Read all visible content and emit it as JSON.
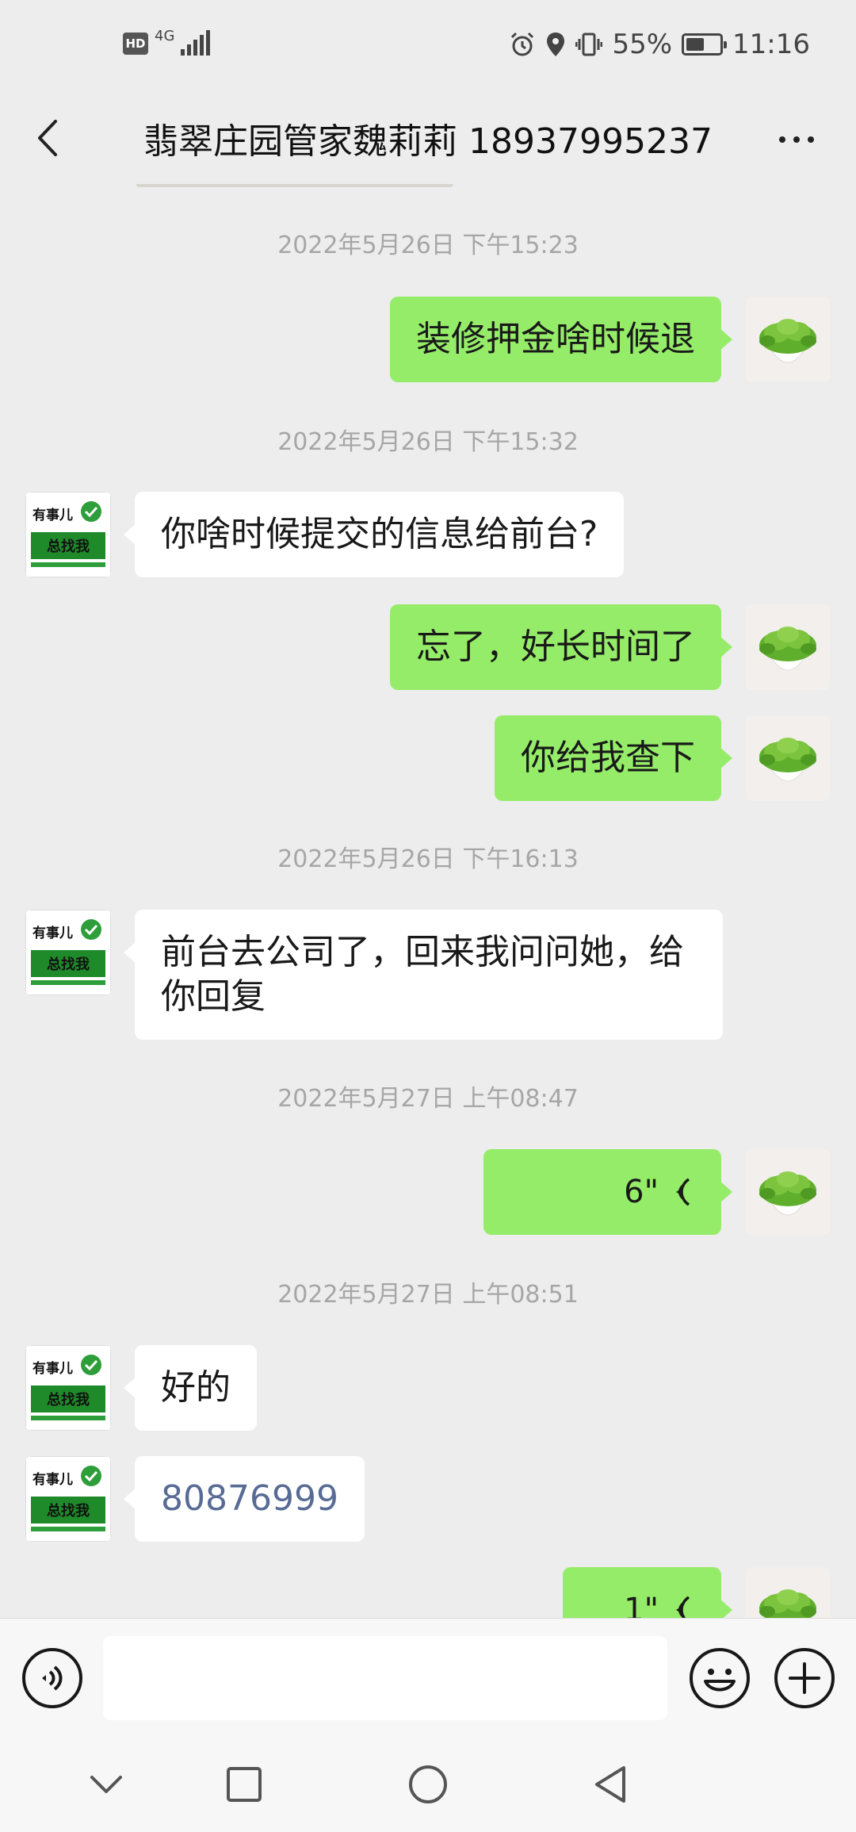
{
  "status_bar": {
    "hd": "HD",
    "network": "4G",
    "battery_percent": "55%",
    "battery_level": 0.55,
    "time": "11:16"
  },
  "nav": {
    "title": "翡翠庄园管家魏莉莉 18937995237",
    "back_icon": "chevron-left-icon",
    "more_icon": "more-dots-icon"
  },
  "messages": [
    {
      "type": "timestamp",
      "text": "2022年5月26日 下午15:23"
    },
    {
      "type": "text",
      "sender": "self",
      "text": "装修押金啥时候退"
    },
    {
      "type": "timestamp",
      "text": "2022年5月26日 下午15:32"
    },
    {
      "type": "text",
      "sender": "other",
      "text": "你啥时候提交的信息给前台?"
    },
    {
      "type": "text",
      "sender": "self",
      "text": "忘了，好长时间了"
    },
    {
      "type": "text",
      "sender": "self",
      "text": "你给我查下"
    },
    {
      "type": "timestamp",
      "text": "2022年5月26日 下午16:13"
    },
    {
      "type": "text",
      "sender": "other",
      "text": "前台去公司了，回来我问问她，给你回复"
    },
    {
      "type": "timestamp",
      "text": "2022年5月27日 上午08:47"
    },
    {
      "type": "voice",
      "sender": "self",
      "duration": "6\""
    },
    {
      "type": "timestamp",
      "text": "2022年5月27日 上午08:51"
    },
    {
      "type": "text",
      "sender": "other",
      "text": "好的"
    },
    {
      "type": "text",
      "sender": "other",
      "text": "80876999"
    },
    {
      "type": "voice",
      "sender": "self",
      "duration": "1\""
    }
  ],
  "avatars": {
    "self": "plant-avatar",
    "other": "logo-avatar",
    "other_logo_top": "有事儿",
    "other_logo_bottom": "总找我"
  },
  "input_bar": {
    "voice_icon": "voice-toggle-icon",
    "emoji_icon": "emoji-icon",
    "plus_icon": "plus-icon",
    "value": ""
  },
  "system_nav": {
    "icons": [
      "chevron-down-icon",
      "square-icon",
      "circle-icon",
      "triangle-back-icon"
    ]
  },
  "colors": {
    "background": "#ededed",
    "bubble_self": "#95ec69",
    "bubble_other": "#ffffff",
    "timestamp": "#a6a6a6",
    "link_number": "#576b95"
  }
}
